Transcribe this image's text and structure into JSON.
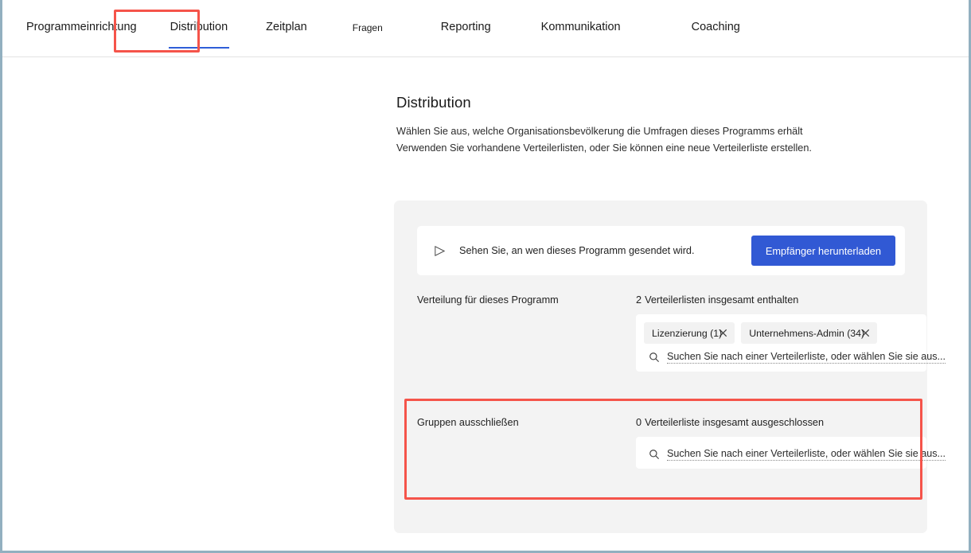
{
  "tabs": [
    {
      "id": "programmeinrichtung",
      "label": "Programmeinrichtung",
      "active": false,
      "small": false
    },
    {
      "id": "distribution",
      "label": "Distribution",
      "active": true,
      "small": false
    },
    {
      "id": "zeitplan",
      "label": "Zeitplan",
      "active": false,
      "small": false
    },
    {
      "id": "fragen",
      "label": "Fragen",
      "active": false,
      "small": true
    },
    {
      "id": "reporting",
      "label": "Reporting",
      "active": false,
      "small": false
    },
    {
      "id": "kommunikation",
      "label": "Kommunikation",
      "active": false,
      "small": false
    },
    {
      "id": "coaching",
      "label": "Coaching",
      "active": false,
      "small": false
    }
  ],
  "page": {
    "title": "Distribution",
    "description_line1": "Wählen Sie aus, welche Organisationsbevölkerung die Umfragen dieses Programms erhält",
    "description_line2": "Verwenden Sie vorhandene Verteilerlisten, oder Sie können eine neue Verteilerliste erstellen."
  },
  "download_bar": {
    "icon": "send-icon",
    "text": "Sehen Sie, an wen dieses Programm gesendet wird.",
    "button_label": "Empfänger herunterladen"
  },
  "distribution_row": {
    "label": "Verteilung für dieses Programm",
    "count": "2",
    "count_text": "Verteilerlisten insgesamt enthalten",
    "chips": [
      {
        "label": "Lizenzierung (1)",
        "remove_icon": "close-icon"
      },
      {
        "label": "Unternehmens-Admin (34)",
        "remove_icon": "close-icon"
      }
    ],
    "search_icon": "search-icon",
    "search_placeholder": "Suchen Sie nach einer Verteilerliste, oder wählen Sie sie aus..."
  },
  "exclude_row": {
    "label": "Gruppen ausschließen",
    "count": "0",
    "count_text": "Verteilerliste insgesamt ausgeschlossen",
    "search_icon": "search-icon",
    "search_placeholder": "Suchen Sie nach einer Verteilerliste, oder wählen Sie sie aus..."
  },
  "colors": {
    "accent_blue": "#3159d4",
    "highlight_red": "#f5544a",
    "panel_gray": "#f3f3f3",
    "window_border": "#92b0c0"
  }
}
